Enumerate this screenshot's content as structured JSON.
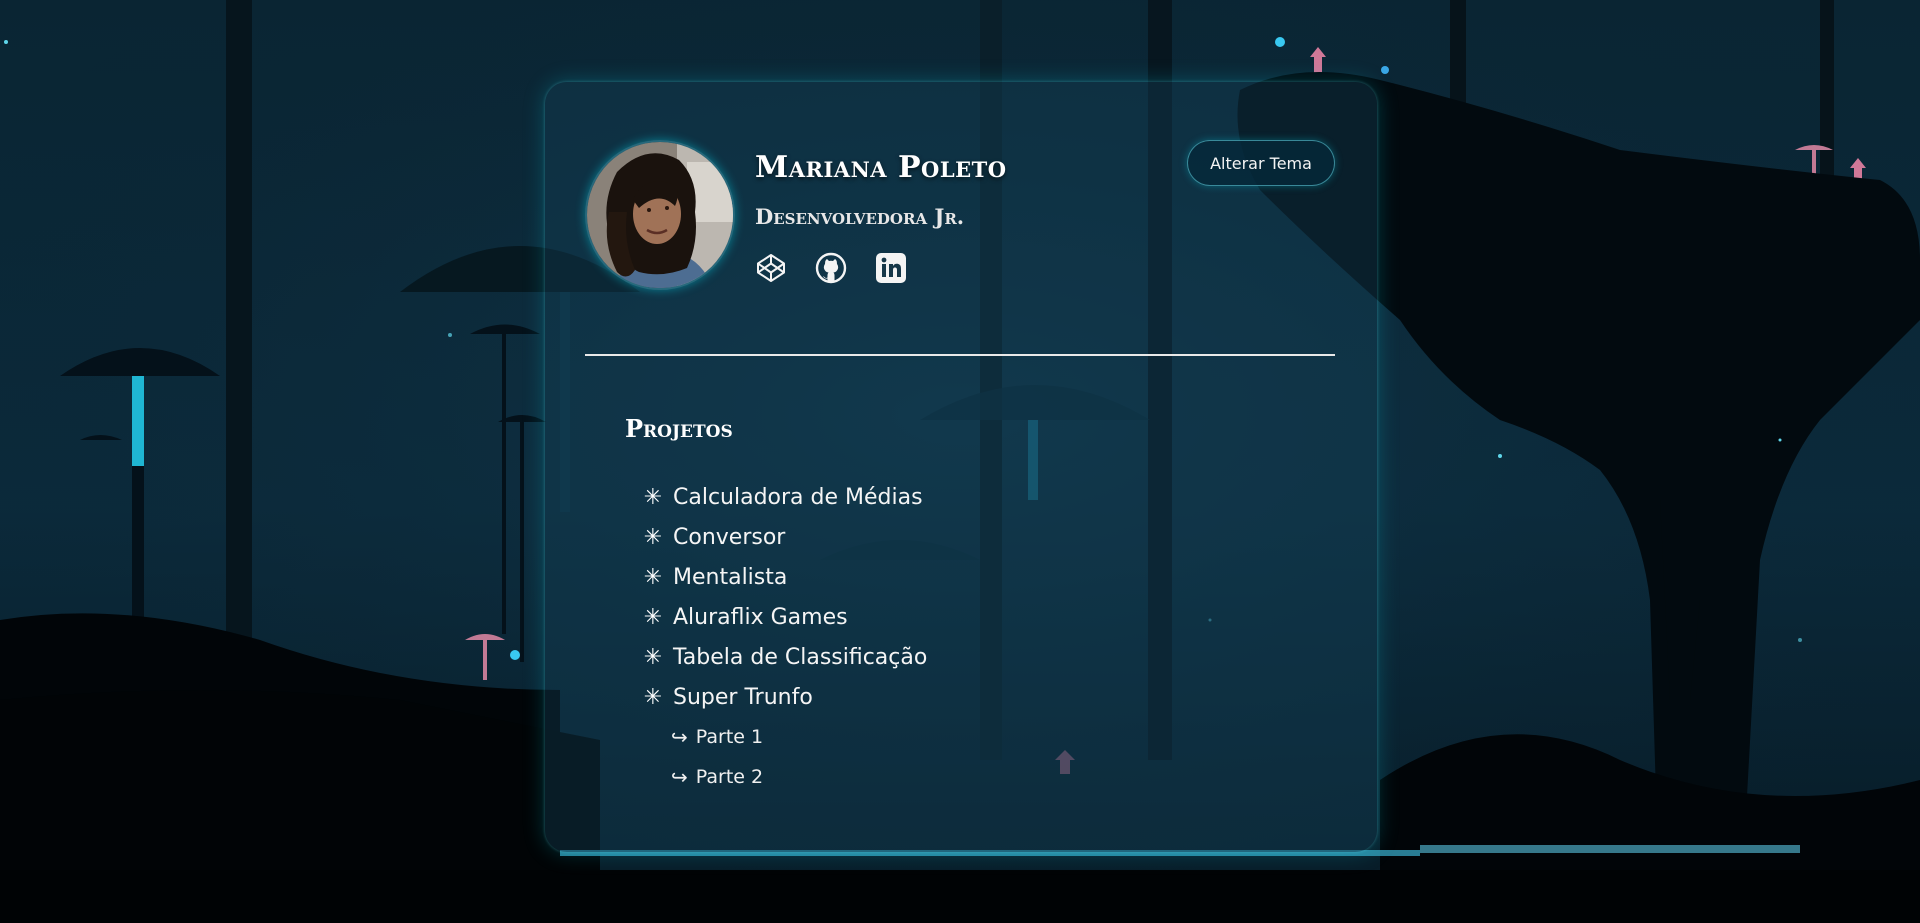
{
  "profile": {
    "name": "Mariana Poleto",
    "role": "Desenvolvedora Jr."
  },
  "theme_button": {
    "label": "Alterar Tema"
  },
  "socials": [
    {
      "icon": "codepen-icon"
    },
    {
      "icon": "github-icon"
    },
    {
      "icon": "linkedin-icon"
    }
  ],
  "projects": {
    "title": "Projetos",
    "items": [
      {
        "label": "Calculadora de Médias"
      },
      {
        "label": "Conversor"
      },
      {
        "label": "Mentalista"
      },
      {
        "label": "Aluraflix Games"
      },
      {
        "label": "Tabela de Classificação"
      },
      {
        "label": "Super Trunfo"
      }
    ],
    "subitems": [
      {
        "label": "Parte 1"
      },
      {
        "label": "Parte 2"
      }
    ]
  },
  "colors": {
    "background": "#04141d",
    "card": "#143e54",
    "accent_glow": "#00d2e6",
    "text": "#ffffff"
  }
}
